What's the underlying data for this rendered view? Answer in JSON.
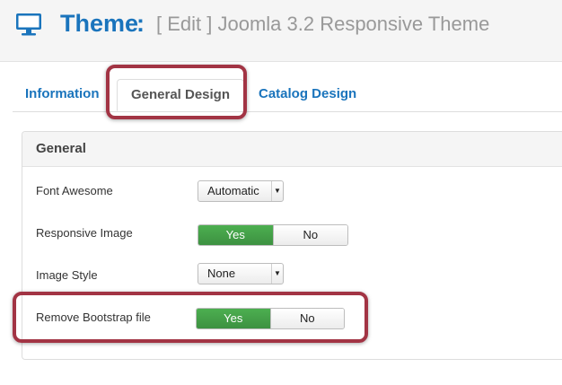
{
  "header": {
    "icon": "monitor-icon",
    "title": "Theme",
    "colon": ":",
    "subtitle": "[ Edit ] Joomla 3.2 Responsive Theme"
  },
  "tabs": [
    {
      "label": "Information",
      "active": false
    },
    {
      "label": "General Design",
      "active": true
    },
    {
      "label": "Catalog Design",
      "active": false
    }
  ],
  "panel": {
    "title": "General",
    "rows": [
      {
        "label": "Font Awesome",
        "control": "select",
        "value": "Automatic"
      },
      {
        "label": "Responsive Image",
        "control": "toggle",
        "yes": "Yes",
        "no": "No",
        "selected": "Yes"
      },
      {
        "label": "Image Style",
        "control": "select",
        "value": "None"
      },
      {
        "label": "Remove Bootstrap file",
        "control": "toggle",
        "yes": "Yes",
        "no": "No",
        "selected": "Yes"
      }
    ]
  },
  "colors": {
    "accent": "#1a74bc",
    "toggle_active": "#43a047",
    "highlight": "#a23444"
  }
}
